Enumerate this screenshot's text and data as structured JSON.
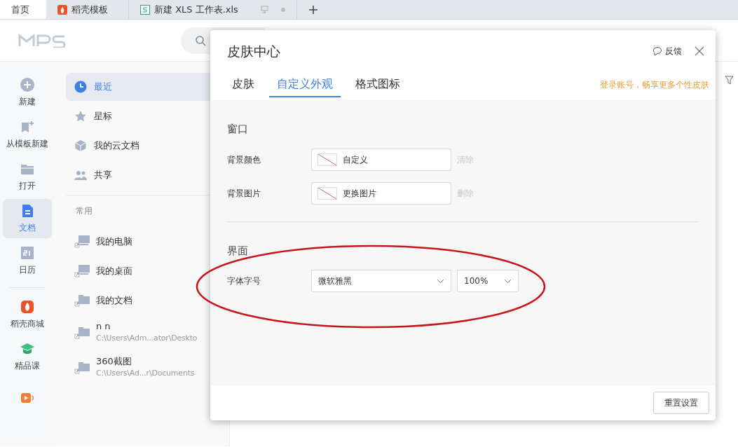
{
  "tabs": [
    {
      "label": "首页",
      "kind": "home",
      "selected": true
    },
    {
      "label": "稻壳模板",
      "kind": "docer",
      "selected": false
    },
    {
      "label": "新建 XLS 工作表.xls",
      "kind": "sheet",
      "selected": false
    }
  ],
  "rail": [
    {
      "label": "新建",
      "kind": "plus",
      "selected": false
    },
    {
      "label": "从模板新建",
      "kind": "template",
      "selected": false
    },
    {
      "label": "打开",
      "kind": "folder",
      "selected": false
    },
    {
      "label": "文档",
      "kind": "doc",
      "selected": true
    },
    {
      "label": "日历",
      "kind": "calendar",
      "selected": false
    },
    {
      "label": "稻壳商城",
      "kind": "docer",
      "selected": false
    },
    {
      "label": "精品课",
      "kind": "course",
      "selected": false
    },
    {
      "kind": "meeting",
      "selected": false
    }
  ],
  "nav": [
    {
      "label": "最近",
      "kind": "clock",
      "selected": true
    },
    {
      "label": "星标",
      "kind": "star",
      "selected": false
    },
    {
      "label": "我的云文档",
      "kind": "cube",
      "selected": false
    },
    {
      "label": "共享",
      "kind": "people",
      "selected": false
    }
  ],
  "common": {
    "title": "常用",
    "items": [
      {
        "label": "我的电脑",
        "kind": "monitor"
      },
      {
        "label": "我的桌面",
        "kind": "monitor"
      },
      {
        "label": "我的文档",
        "kind": "folder"
      },
      {
        "label": "n n",
        "path": "C:\\Users\\Adm...ator\\Deskto",
        "kind": "folder"
      },
      {
        "label": "360截图",
        "path": "C:\\Users\\Ad...r\\Documents",
        "kind": "folder"
      }
    ]
  },
  "dialog": {
    "title": "皮肤中心",
    "feedback": "反馈",
    "tabs": [
      {
        "label": "皮肤",
        "selected": false
      },
      {
        "label": "自定义外观",
        "selected": true
      },
      {
        "label": "格式图标",
        "selected": false
      }
    ],
    "promo": "登录账号，畅享更多个性皮肤",
    "sections": [
      {
        "title": "窗口",
        "rows": [
          {
            "kind": "swatch",
            "label": "背景颜色",
            "value": "自定义",
            "action": "清除"
          },
          {
            "kind": "swatch",
            "label": "背景图片",
            "value": "更换图片",
            "action": "删除"
          }
        ]
      },
      {
        "title": "界面",
        "rows": [
          {
            "kind": "font",
            "label": "字体字号",
            "value": "微软雅黑",
            "size": "100%"
          }
        ]
      }
    ],
    "reset_button": "重置设置"
  }
}
